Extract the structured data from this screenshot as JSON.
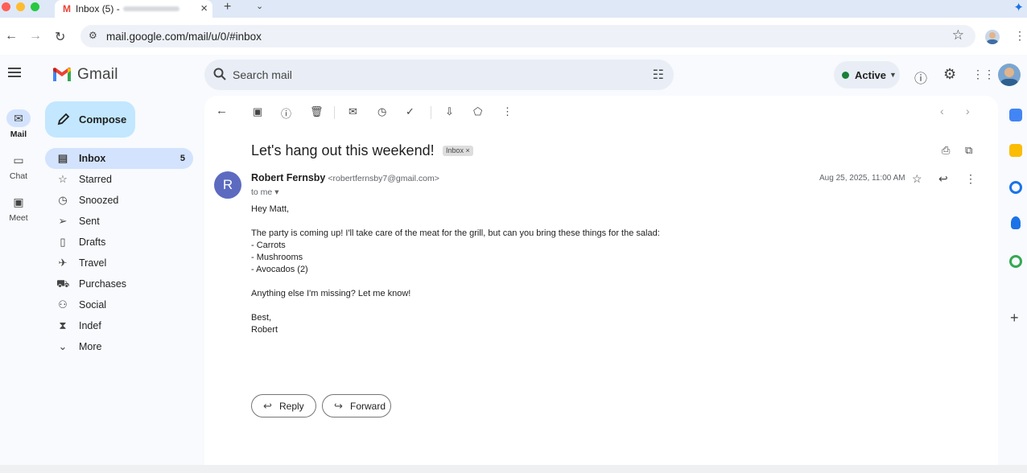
{
  "browser": {
    "tab_title": "Inbox (5) -",
    "new_tab": "+",
    "url": "mail.google.com/mail/u/0/#inbox"
  },
  "app": {
    "logo_text": "Gmail",
    "search_placeholder": "Search mail",
    "status_label": "Active"
  },
  "rail": [
    {
      "label": "Mail",
      "icon": "mail-icon"
    },
    {
      "label": "Chat",
      "icon": "chat-icon"
    },
    {
      "label": "Meet",
      "icon": "video-icon"
    }
  ],
  "compose_label": "Compose",
  "nav": [
    {
      "label": "Inbox",
      "count": "5",
      "icon": "inbox-icon"
    },
    {
      "label": "Starred",
      "icon": "star-icon"
    },
    {
      "label": "Snoozed",
      "icon": "clock-icon"
    },
    {
      "label": "Sent",
      "icon": "send-icon"
    },
    {
      "label": "Drafts",
      "icon": "draft-icon"
    },
    {
      "label": "Travel",
      "icon": "plane-icon"
    },
    {
      "label": "Purchases",
      "icon": "cart-icon"
    },
    {
      "label": "Social",
      "icon": "people-icon"
    },
    {
      "label": "Indef",
      "icon": "hourglass-icon"
    },
    {
      "label": "More",
      "icon": "chevron-down-icon"
    }
  ],
  "message": {
    "subject": "Let's hang out this weekend!",
    "label_chip": "Inbox",
    "sender_initial": "R",
    "sender_name": "Robert Fernsby",
    "sender_email": "<robertfernsby7@gmail.com>",
    "to": "to me",
    "date": "Aug 25, 2025, 11:00 AM",
    "body": [
      "Hey Matt,",
      "",
      "The party is coming up! I'll take care of the meat for the grill, but can you bring these things for the salad:",
      "- Carrots",
      "- Mushrooms",
      "- Avocados (2)",
      "",
      "Anything else I'm missing? Let me know!",
      "",
      "Best,",
      "Robert"
    ],
    "reply_label": "Reply",
    "forward_label": "Forward"
  },
  "colors": {
    "compose_bg": "#c2e7ff",
    "active_nav_bg": "#d3e3fd",
    "status_dot": "#188038",
    "sender_avatar": "#5c6bc0"
  }
}
